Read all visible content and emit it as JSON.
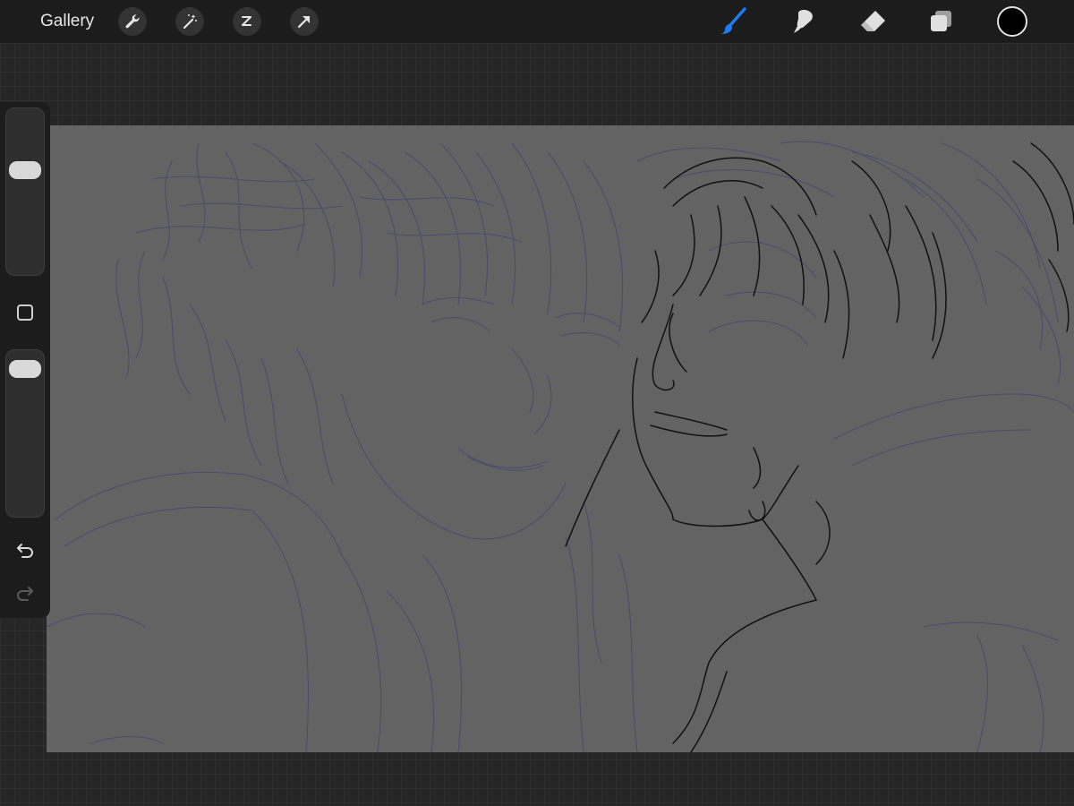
{
  "toolbar": {
    "gallery_label": "Gallery",
    "left_tools": [
      "wrench-icon",
      "magic-wand-icon",
      "selection-icon",
      "transform-arrow-icon"
    ],
    "right_tools": [
      "brush-icon",
      "smudge-icon",
      "eraser-icon",
      "layers-icon"
    ],
    "active_tool": "brush",
    "active_color": "#000000",
    "accent_color": "#1e7cf2"
  },
  "sidebar": {
    "brush_size_level": 0.65,
    "opacity_level": 0.95,
    "buttons": [
      "modify-square-icon",
      "undo-icon",
      "redo-icon"
    ]
  },
  "canvas": {
    "background_color": "#636363",
    "sketch_color": "#4a4870",
    "lineart_color": "#111111"
  }
}
